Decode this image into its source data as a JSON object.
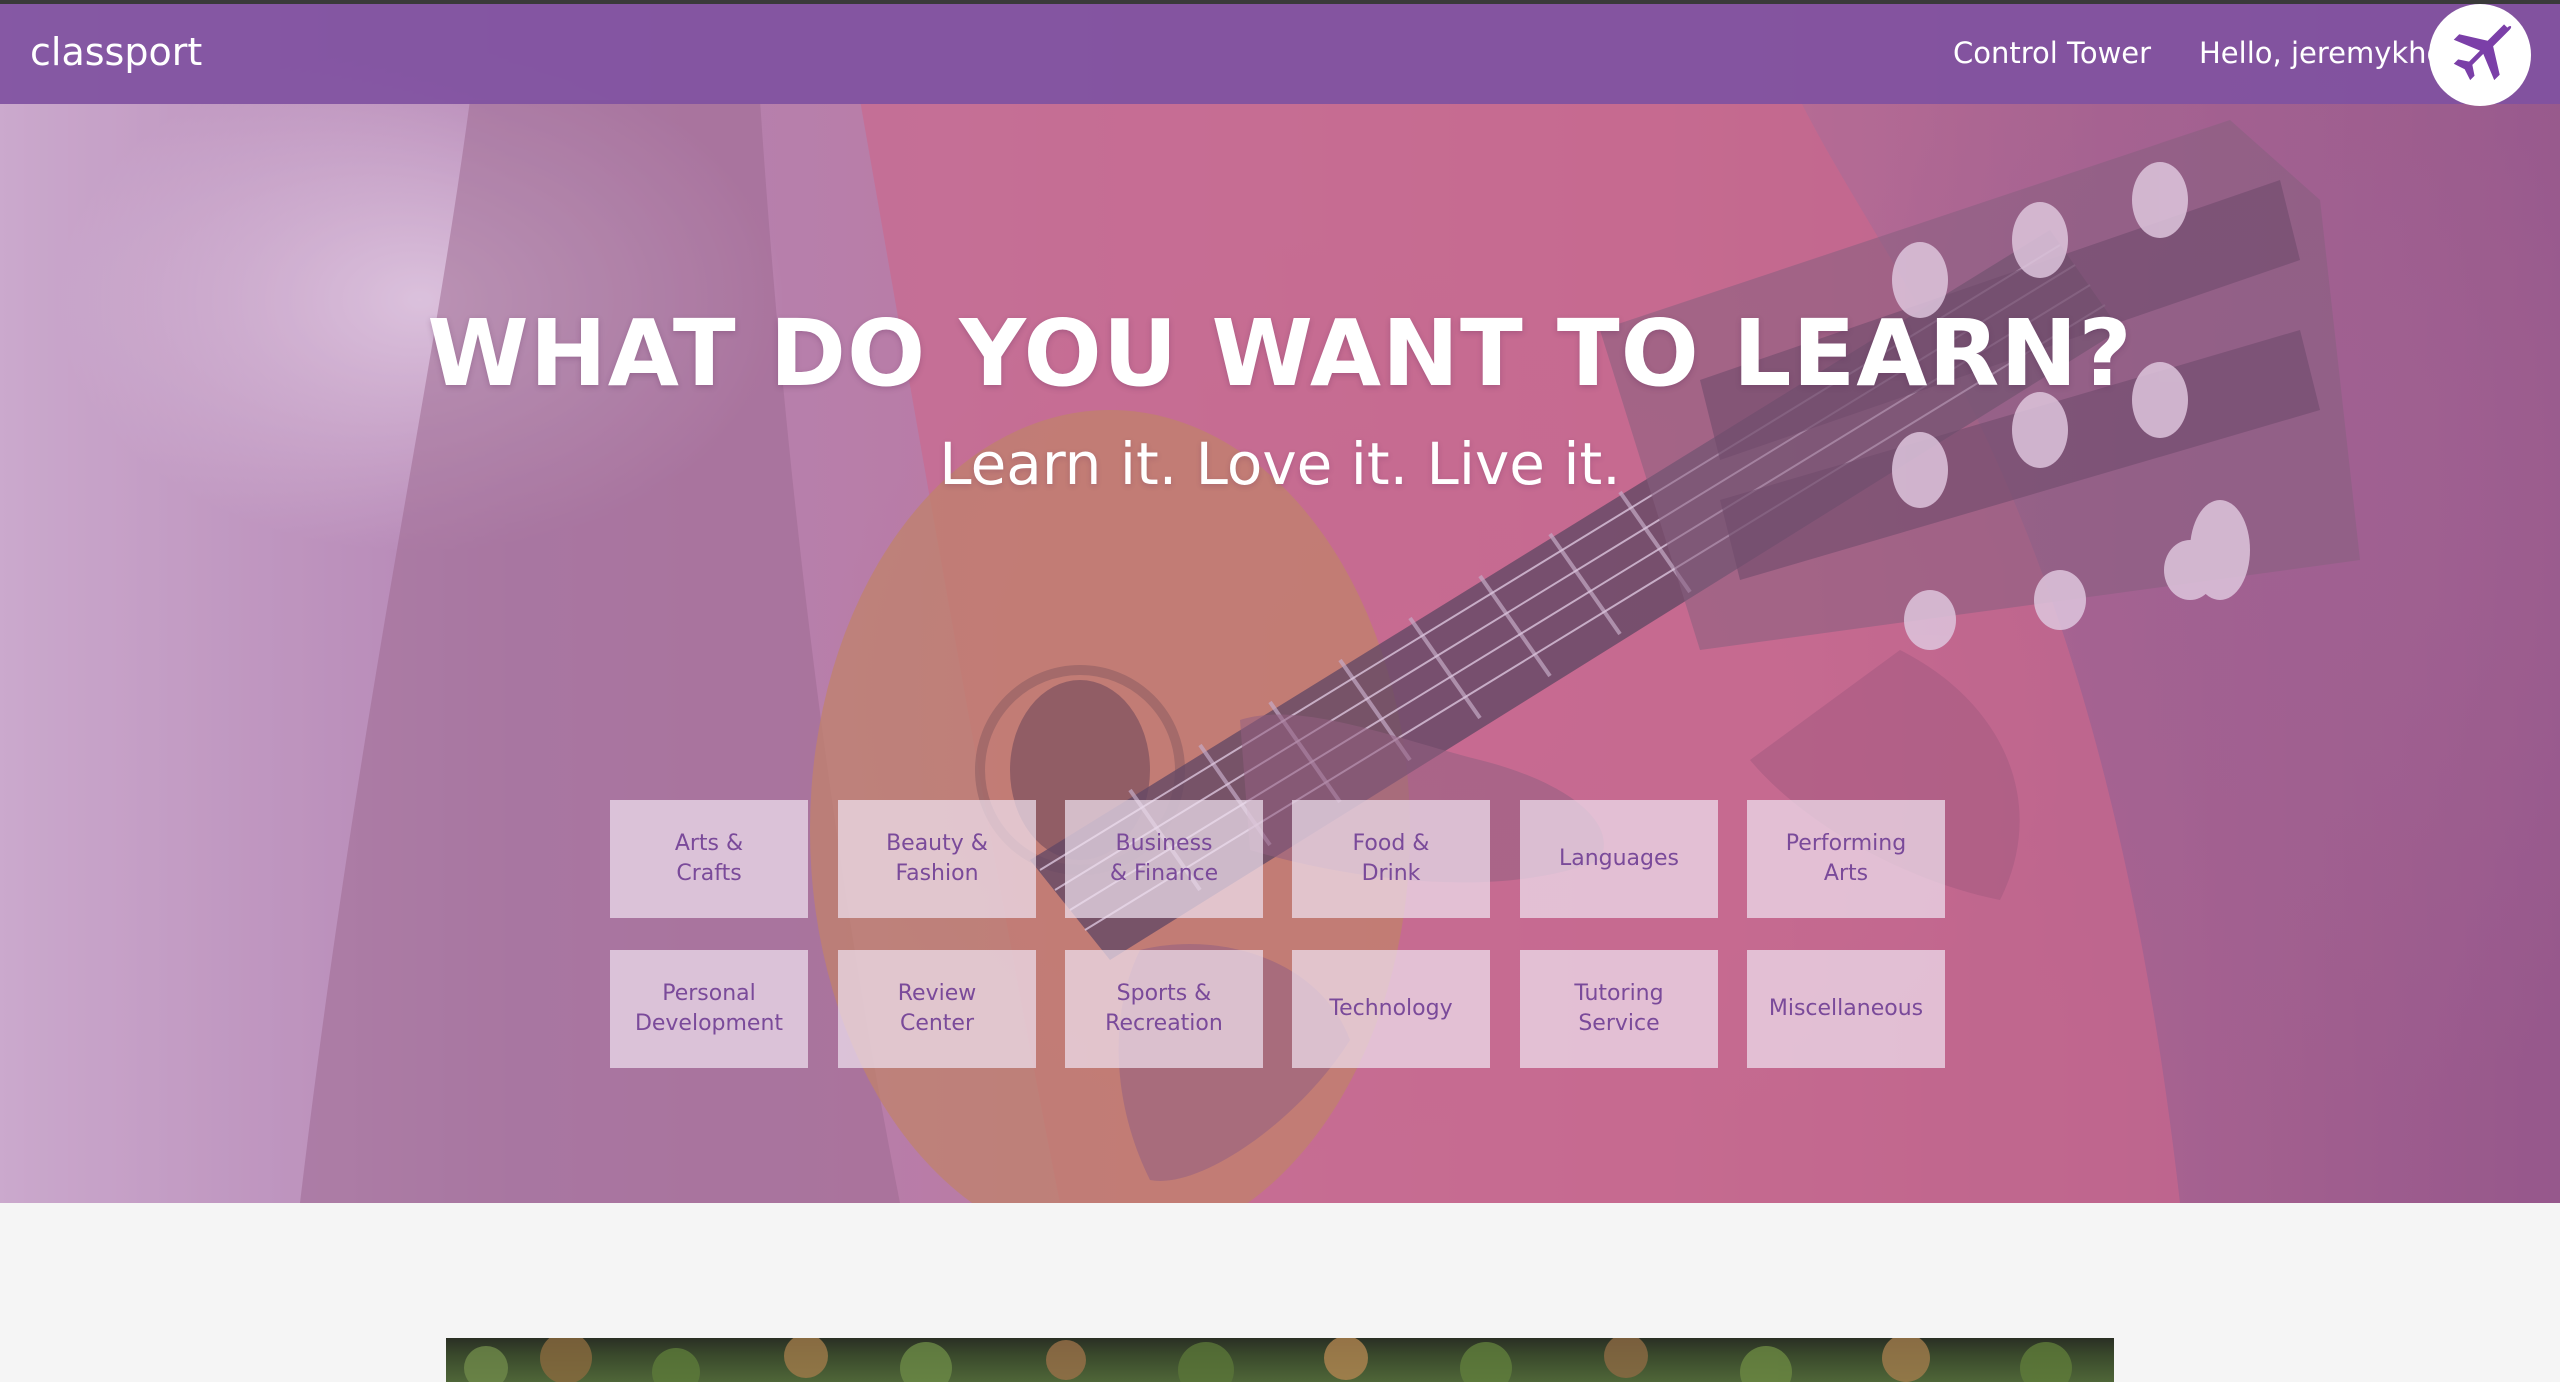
{
  "navbar": {
    "brand": "classport",
    "control_tower": "Control Tower",
    "greeting": "Hello, jeremykho",
    "avatar_icon": "airplane-icon"
  },
  "hero": {
    "headline": "WHAT DO YOU WANT TO LEARN?",
    "subhead": "Learn it. Love it. Live it.",
    "categories": [
      {
        "label": "Arts &\nCrafts"
      },
      {
        "label": "Beauty &\nFashion"
      },
      {
        "label": "Business\n& Finance"
      },
      {
        "label": "Food &\nDrink"
      },
      {
        "label": "Languages"
      },
      {
        "label": "Performing\nArts"
      },
      {
        "label": "Personal\nDevelopment"
      },
      {
        "label": "Review\nCenter"
      },
      {
        "label": "Sports &\nRecreation"
      },
      {
        "label": "Technology"
      },
      {
        "label": "Tutoring\nService"
      },
      {
        "label": "Miscellaneous"
      }
    ]
  },
  "colors": {
    "nav_purple": "#8052a0",
    "tile_text": "#7a4a9a",
    "avatar_icon": "#7b3fa8"
  }
}
